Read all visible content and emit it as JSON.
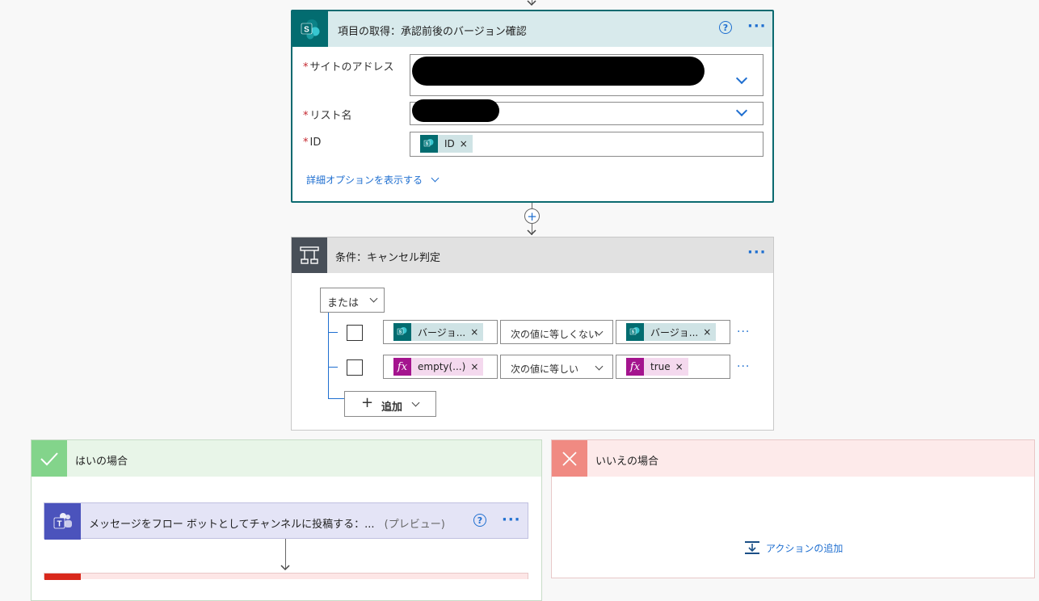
{
  "get_item": {
    "title": "項目の取得：承認前後のバージョン確認",
    "help": "?",
    "more": "···",
    "site_label": "サイトのアドレス",
    "list_label": "リスト名",
    "id_label": "ID",
    "required_mark": "*",
    "id_token": "ID",
    "token_remove": "×",
    "advanced": "詳細オプションを表示する"
  },
  "condition": {
    "title": "条件：キャンセル判定",
    "more": "···",
    "group_op": "または",
    "rows": [
      {
        "left": "バージョ...",
        "operator": "次の値に等しくない",
        "right": "バージョ..."
      },
      {
        "left": "empty(...)",
        "operator": "次の値に等しい",
        "right": "true"
      }
    ],
    "row_more": "···",
    "add_label": "追加",
    "fx": "fx"
  },
  "yes_branch": {
    "title": "はいの場合",
    "teams_action": "メッセージをフロー ボットとしてチャンネルに投稿する：...",
    "preview": "(プレビュー)",
    "help": "?",
    "more": "···"
  },
  "no_branch": {
    "title": "いいえの場合",
    "add_action": "アクションの追加"
  },
  "colors": {
    "sharepoint": "#036c70",
    "teams": "#4b53bc",
    "accent": "#1f6fd0",
    "expression": "#a4148e"
  }
}
